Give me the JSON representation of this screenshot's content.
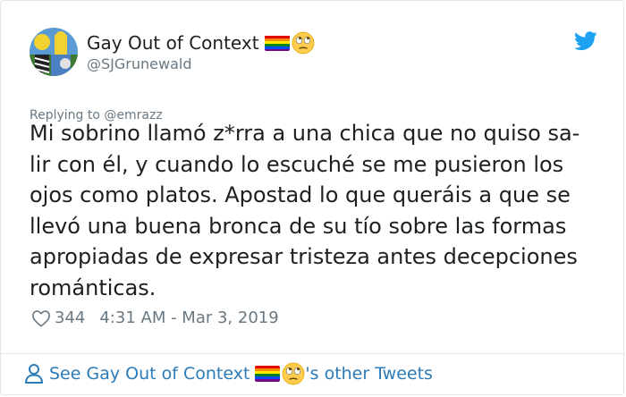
{
  "author": {
    "display_name": "Gay Out of Context",
    "handle": "@SJGrunewald",
    "name_emojis": [
      "rainbow-flag",
      "face-with-rolling-eyes"
    ]
  },
  "reply": {
    "text": "Replying to @emrazz"
  },
  "tweet": {
    "text": "Mi sobrino llamó z*rra a una chica que no quiso sa-\nlir con él, y cuando lo escuché se me pusieron los\nojos como platos. Apostad lo que queráis a que se\nllevó una buena bronca de su tío sobre las formas\napropiadas de expresar tristeza antes decepciones\nrománticas."
  },
  "stats": {
    "likes": "344",
    "timestamp": "4:31 AM - Mar 3, 2019"
  },
  "footer": {
    "prefix": "See Gay Out of Context",
    "suffix": "'s other Tweets"
  },
  "icons": {
    "bird": "twitter-bird-icon",
    "like": "heart-icon",
    "profile": "person-icon"
  },
  "colors": {
    "link": "#2b7bb9",
    "twitter_blue": "#1da1f2",
    "muted_text": "#697882",
    "body_text": "#1c2022",
    "border": "#e1e8ed"
  }
}
